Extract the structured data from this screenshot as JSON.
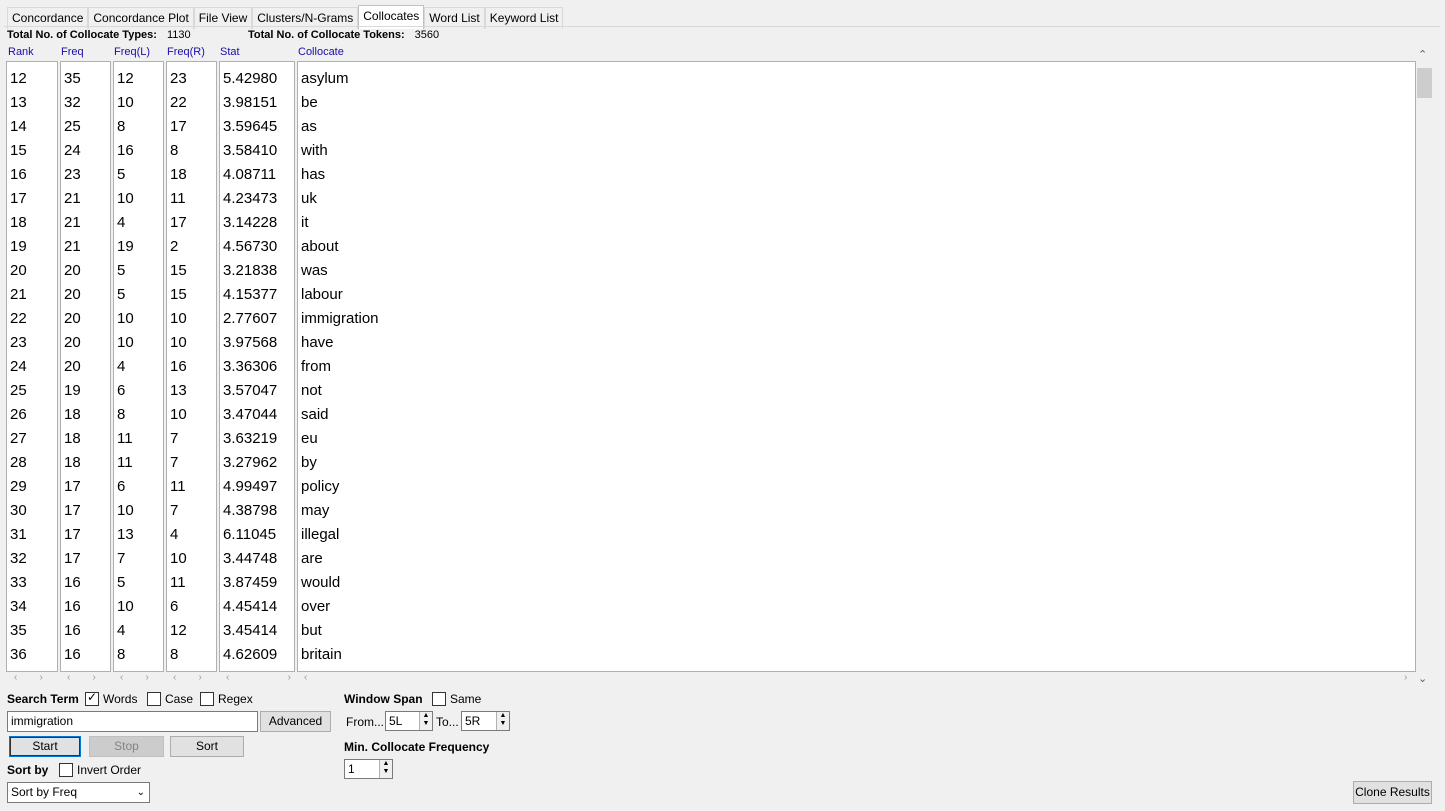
{
  "tabs": [
    "Concordance",
    "Concordance Plot",
    "File View",
    "Clusters/N-Grams",
    "Collocates",
    "Word List",
    "Keyword List"
  ],
  "active_tab": "Collocates",
  "totals": {
    "types_label": "Total No. of Collocate Types:",
    "types_value": "1130",
    "tokens_label": "Total No. of Collocate Tokens:",
    "tokens_value": "3560"
  },
  "columns": [
    "Rank",
    "Freq",
    "Freq(L)",
    "Freq(R)",
    "Stat",
    "Collocate"
  ],
  "rows": [
    [
      "12",
      "35",
      "12",
      "23",
      "5.42980",
      "asylum"
    ],
    [
      "13",
      "32",
      "10",
      "22",
      "3.98151",
      "be"
    ],
    [
      "14",
      "25",
      "8",
      "17",
      "3.59645",
      "as"
    ],
    [
      "15",
      "24",
      "16",
      "8",
      "3.58410",
      "with"
    ],
    [
      "16",
      "23",
      "5",
      "18",
      "4.08711",
      "has"
    ],
    [
      "17",
      "21",
      "10",
      "11",
      "4.23473",
      "uk"
    ],
    [
      "18",
      "21",
      "4",
      "17",
      "3.14228",
      "it"
    ],
    [
      "19",
      "21",
      "19",
      "2",
      "4.56730",
      "about"
    ],
    [
      "20",
      "20",
      "5",
      "15",
      "3.21838",
      "was"
    ],
    [
      "21",
      "20",
      "5",
      "15",
      "4.15377",
      "labour"
    ],
    [
      "22",
      "20",
      "10",
      "10",
      "2.77607",
      "immigration"
    ],
    [
      "23",
      "20",
      "10",
      "10",
      "3.97568",
      "have"
    ],
    [
      "24",
      "20",
      "4",
      "16",
      "3.36306",
      "from"
    ],
    [
      "25",
      "19",
      "6",
      "13",
      "3.57047",
      "not"
    ],
    [
      "26",
      "18",
      "8",
      "10",
      "3.47044",
      "said"
    ],
    [
      "27",
      "18",
      "11",
      "7",
      "3.63219",
      "eu"
    ],
    [
      "28",
      "18",
      "11",
      "7",
      "3.27962",
      "by"
    ],
    [
      "29",
      "17",
      "6",
      "11",
      "4.99497",
      "policy"
    ],
    [
      "30",
      "17",
      "10",
      "7",
      "4.38798",
      "may"
    ],
    [
      "31",
      "17",
      "13",
      "4",
      "6.11045",
      "illegal"
    ],
    [
      "32",
      "17",
      "7",
      "10",
      "3.44748",
      "are"
    ],
    [
      "33",
      "16",
      "5",
      "11",
      "3.87459",
      "would"
    ],
    [
      "34",
      "16",
      "10",
      "6",
      "4.45414",
      "over"
    ],
    [
      "35",
      "16",
      "4",
      "12",
      "3.45414",
      "but"
    ],
    [
      "36",
      "16",
      "8",
      "8",
      "4.62609",
      "britain"
    ]
  ],
  "search": {
    "label": "Search Term",
    "words_label": "Words",
    "words_checked": true,
    "case_label": "Case",
    "case_checked": false,
    "regex_label": "Regex",
    "regex_checked": false,
    "value": "immigration",
    "advanced_label": "Advanced"
  },
  "buttons": {
    "start": "Start",
    "stop": "Stop",
    "sort": "Sort",
    "clone": "Clone Results"
  },
  "sort": {
    "label": "Sort by",
    "invert_label": "Invert Order",
    "invert_checked": false,
    "selected": "Sort by Freq"
  },
  "window_span": {
    "label": "Window Span",
    "same_label": "Same",
    "same_checked": false,
    "from_label": "From...",
    "from_value": "5L",
    "to_label": "To...",
    "to_value": "5R"
  },
  "min_freq": {
    "label": "Min. Collocate Frequency",
    "value": "1"
  }
}
